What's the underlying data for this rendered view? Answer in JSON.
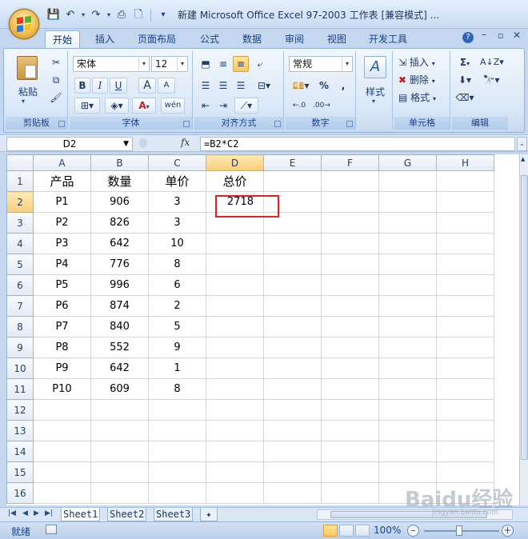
{
  "window": {
    "title": "新建 Microsoft Office Excel 97-2003 工作表 [兼容模式] ..."
  },
  "qat": {
    "icons": [
      "save-icon",
      "undo-icon",
      "redo-icon",
      "print-preview-icon",
      "new-icon",
      "customize-icon"
    ]
  },
  "tabs": [
    "开始",
    "插入",
    "页面布局",
    "公式",
    "数据",
    "审阅",
    "视图",
    "开发工具"
  ],
  "active_tab": "开始",
  "ribbon": {
    "clipboard": {
      "label": "剪贴板",
      "paste": "粘贴"
    },
    "font": {
      "label": "字体",
      "name": "宋体",
      "size": "12",
      "bold": "B",
      "italic": "I",
      "underline": "U",
      "grow": "A",
      "shrink": "A",
      "color": "A",
      "wen": "wén"
    },
    "alignment": {
      "label": "对齐方式"
    },
    "number": {
      "label": "数字",
      "format": "常规",
      "percent": "%",
      "comma": ","
    },
    "styles": {
      "label": "样式"
    },
    "cells": {
      "label": "单元格",
      "insert": "插入",
      "delete": "删除",
      "format": "格式"
    },
    "editing": {
      "label": "编辑",
      "sigma": "Σ"
    }
  },
  "formula_bar": {
    "namebox": "D2",
    "fx": "fx",
    "formula": "=B2*C2"
  },
  "columns": [
    "A",
    "B",
    "C",
    "D",
    "E",
    "F",
    "G",
    "H"
  ],
  "rows": [
    {
      "n": "1",
      "a": "产品",
      "b": "数量",
      "c": "单价",
      "d": "总价"
    },
    {
      "n": "2",
      "a": "P1",
      "b": "906",
      "c": "3",
      "d": "2718"
    },
    {
      "n": "3",
      "a": "P2",
      "b": "826",
      "c": "3",
      "d": ""
    },
    {
      "n": "4",
      "a": "P3",
      "b": "642",
      "c": "10",
      "d": ""
    },
    {
      "n": "5",
      "a": "P4",
      "b": "776",
      "c": "8",
      "d": ""
    },
    {
      "n": "6",
      "a": "P5",
      "b": "996",
      "c": "6",
      "d": ""
    },
    {
      "n": "7",
      "a": "P6",
      "b": "874",
      "c": "2",
      "d": ""
    },
    {
      "n": "8",
      "a": "P7",
      "b": "840",
      "c": "5",
      "d": ""
    },
    {
      "n": "9",
      "a": "P8",
      "b": "552",
      "c": "9",
      "d": ""
    },
    {
      "n": "10",
      "a": "P9",
      "b": "642",
      "c": "1",
      "d": ""
    },
    {
      "n": "11",
      "a": "P10",
      "b": "609",
      "c": "8",
      "d": ""
    },
    {
      "n": "12",
      "a": "",
      "b": "",
      "c": "",
      "d": ""
    },
    {
      "n": "13",
      "a": "",
      "b": "",
      "c": "",
      "d": ""
    },
    {
      "n": "14",
      "a": "",
      "b": "",
      "c": "",
      "d": ""
    },
    {
      "n": "15",
      "a": "",
      "b": "",
      "c": "",
      "d": ""
    },
    {
      "n": "16",
      "a": "",
      "b": "",
      "c": "",
      "d": ""
    }
  ],
  "sheet_tabs": [
    "Sheet1",
    "Sheet2",
    "Sheet3"
  ],
  "active_sheet": "Sheet1",
  "status": {
    "ready": "就绪",
    "zoom": "100%"
  },
  "watermark": {
    "main": "Baidu经验",
    "sub": "jingyan.baidu.com"
  },
  "colors": {
    "selection": "#e62020",
    "ribbon": "#dbe8f7",
    "accent": "#15428b"
  }
}
